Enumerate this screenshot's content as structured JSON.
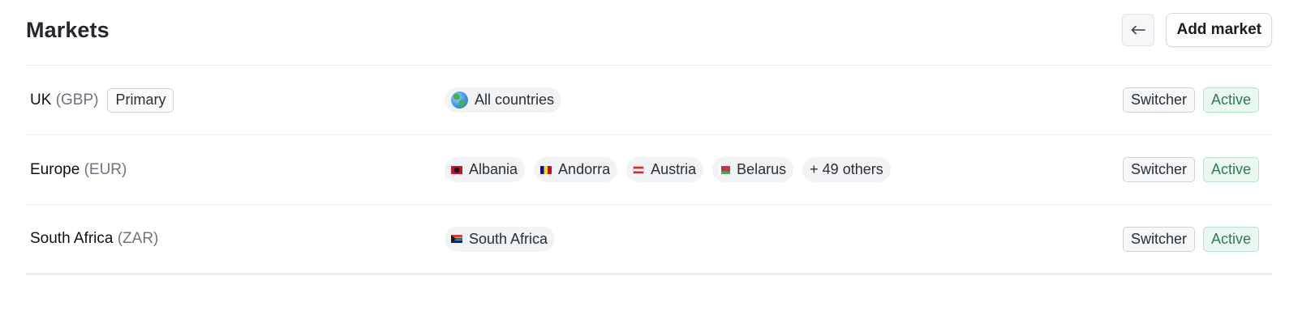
{
  "header": {
    "title": "Markets",
    "back_icon": "arrow-left-icon",
    "add_label": "Add market"
  },
  "markets": [
    {
      "name": "UK",
      "currency": "(GBP)",
      "badge": "Primary",
      "countries": [
        {
          "label": "All countries",
          "icon": "globe-icon"
        }
      ],
      "switcher": "Switcher",
      "status": "Active"
    },
    {
      "name": "Europe",
      "currency": "(EUR)",
      "countries": [
        {
          "label": "Albania",
          "icon": "flag-albania"
        },
        {
          "label": "Andorra",
          "icon": "flag-andorra"
        },
        {
          "label": "Austria",
          "icon": "flag-austria"
        },
        {
          "label": "Belarus",
          "icon": "flag-belarus"
        }
      ],
      "others": "+ 49 others",
      "switcher": "Switcher",
      "status": "Active"
    },
    {
      "name": "South Africa",
      "currency": "(ZAR)",
      "countries": [
        {
          "label": "South Africa",
          "icon": "flag-south-africa"
        }
      ],
      "switcher": "Switcher",
      "status": "Active"
    }
  ],
  "colors": {
    "status_active_bg": "#eaf8f0",
    "status_active_text": "#2f7a55",
    "chip_bg": "#f2f3f5",
    "border": "#eceef1"
  }
}
